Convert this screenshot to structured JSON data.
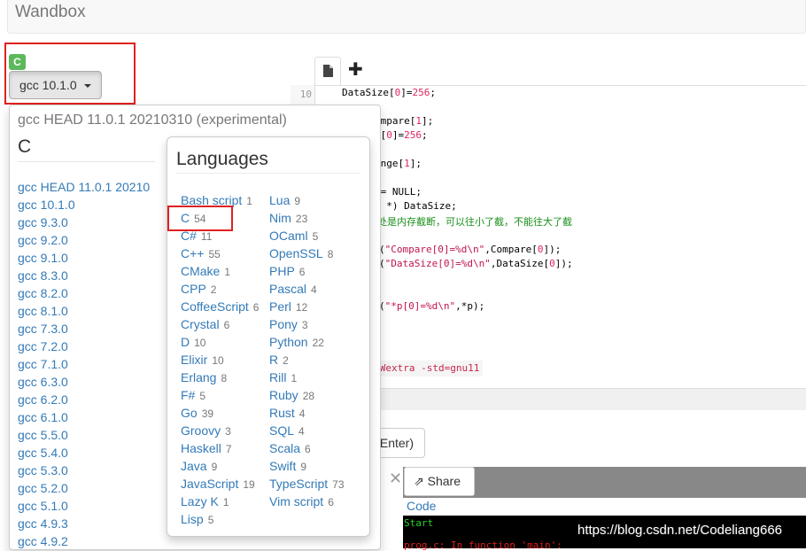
{
  "brand": "Wandbox",
  "language_badge": "C",
  "compiler_button": {
    "label": "gcc 10.1.0"
  },
  "editor": {
    "line_number": "10",
    "lines": [
      [
        "DataSize[",
        "0",
        "]=",
        "256",
        ";"
      ],
      [
        "ompare[",
        "1",
        "];"
      ],
      [
        "e[",
        "0",
        "]=",
        "256",
        ";"
      ],
      [
        "ange[",
        "1",
        "];"
      ],
      [
        "p= NULL;"
      ],
      [
        "e *) DataSize;"
      ],
      [
        "处是内存截断，可以往小了截，不能往大了截"
      ],
      [
        "(",
        "\"Compare[0]=%d\\n\"",
        ",Compare[",
        "0",
        "]);"
      ],
      [
        "(",
        "\"DataSize[0]=%d\\n\"",
        ",DataSize[",
        "0",
        "]);"
      ],
      [
        "(",
        "\"*p[0]=%d\\n\"",
        ",*p);"
      ]
    ],
    "options": "Wall -Wextra -std=gnu11"
  },
  "run_button": {
    "label": "Enter)"
  },
  "share_button": {
    "label": "Share"
  },
  "output": {
    "code_tab": "Code",
    "start": "Start",
    "error": "prog.c: In function 'main':"
  },
  "watermark": "https://blog.csdn.net/Codeliang666",
  "compiler_dropdown": {
    "header": "gcc HEAD 11.0.1 20210310 (experimental)",
    "language": "C",
    "items": [
      "gcc HEAD 11.0.1 20210310",
      "gcc 10.1.0",
      "gcc 9.3.0",
      "gcc 9.2.0",
      "gcc 9.1.0",
      "gcc 8.3.0",
      "gcc 8.2.0",
      "gcc 8.1.0",
      "gcc 7.3.0",
      "gcc 7.2.0",
      "gcc 7.1.0",
      "gcc 6.3.0",
      "gcc 6.2.0",
      "gcc 6.1.0",
      "gcc 5.5.0",
      "gcc 5.4.0",
      "gcc 5.3.0",
      "gcc 5.2.0",
      "gcc 5.1.0",
      "gcc 4.9.3",
      "gcc 4.9.2"
    ]
  },
  "languages_popover": {
    "title": "Languages",
    "left": [
      {
        "name": "Bash script",
        "count": "1"
      },
      {
        "name": "C",
        "count": "54"
      },
      {
        "name": "C#",
        "count": "11"
      },
      {
        "name": "C++",
        "count": "55"
      },
      {
        "name": "CMake",
        "count": "1"
      },
      {
        "name": "CPP",
        "count": "2"
      },
      {
        "name": "CoffeeScript",
        "count": "6"
      },
      {
        "name": "Crystal",
        "count": "6"
      },
      {
        "name": "D",
        "count": "10"
      },
      {
        "name": "Elixir",
        "count": "10"
      },
      {
        "name": "Erlang",
        "count": "8"
      },
      {
        "name": "F#",
        "count": "5"
      },
      {
        "name": "Go",
        "count": "39"
      },
      {
        "name": "Groovy",
        "count": "3"
      },
      {
        "name": "Haskell",
        "count": "7"
      },
      {
        "name": "Java",
        "count": "9"
      },
      {
        "name": "JavaScript",
        "count": "19"
      },
      {
        "name": "Lazy K",
        "count": "1"
      },
      {
        "name": "Lisp",
        "count": "5"
      }
    ],
    "right": [
      {
        "name": "Lua",
        "count": "9"
      },
      {
        "name": "Nim",
        "count": "23"
      },
      {
        "name": "OCaml",
        "count": "5"
      },
      {
        "name": "OpenSSL",
        "count": "8"
      },
      {
        "name": "PHP",
        "count": "6"
      },
      {
        "name": "Pascal",
        "count": "4"
      },
      {
        "name": "Perl",
        "count": "12"
      },
      {
        "name": "Pony",
        "count": "3"
      },
      {
        "name": "Python",
        "count": "22"
      },
      {
        "name": "R",
        "count": "2"
      },
      {
        "name": "Rill",
        "count": "1"
      },
      {
        "name": "Ruby",
        "count": "28"
      },
      {
        "name": "Rust",
        "count": "4"
      },
      {
        "name": "SQL",
        "count": "4"
      },
      {
        "name": "Scala",
        "count": "6"
      },
      {
        "name": "Swift",
        "count": "9"
      },
      {
        "name": "TypeScript",
        "count": "73"
      },
      {
        "name": "Vim script",
        "count": "6"
      }
    ]
  }
}
